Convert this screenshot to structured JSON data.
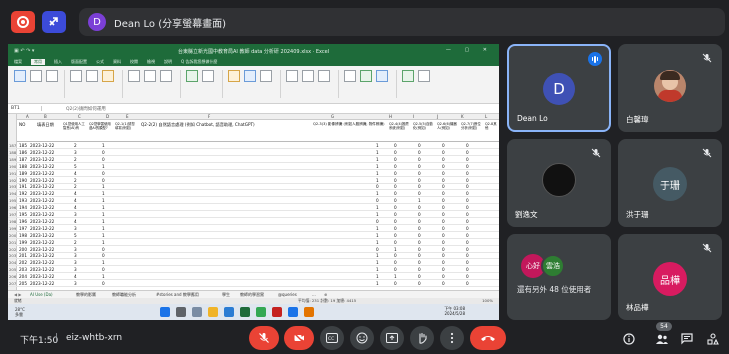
{
  "meeting": {
    "presenter_initial": "D",
    "presenter_label": "Dean Lo (分享螢幕畫面)"
  },
  "excel": {
    "title": "台東縣立新光國中教育局AI 教師 data 分析研 202409.xlsx · Excel",
    "tabs": [
      "檔案",
      "常用",
      "插入",
      "版面配置",
      "公式",
      "資料",
      "校閱",
      "檢視",
      "說明",
      "Q 告訴我您想做什麼"
    ],
    "name_box": "BT1",
    "formula_preview": "Q2(2)請問如何運用",
    "columns": [
      "A",
      "B",
      "C",
      "D",
      "E",
      "F",
      "G",
      "H",
      "I",
      "J",
      "K",
      "L"
    ],
    "headers": [
      "NO",
      "填表日期",
      "Q1您使用人工智慧(AI)有",
      "Q2您學習使用過AI的類型?",
      "Q2-1(1)請您填寫(例如)",
      "Q2-2(2) 自然語言處理 (例如 Chatbot, 語音助理, ChatGPT)",
      "Q2-3(3) 影像辨識 (例如人臉辨識, 物件辨識)",
      "Q2-4(4)推薦系統(例如)",
      "Q2-5(5)自動化(例如)",
      "Q2-6(6)機器人(例如)",
      "Q2-7(7)數位分析(例如)",
      "Q2-8其他"
    ],
    "rows": [
      {
        "rn": "187",
        "no": "185",
        "date": "2023-12-22",
        "c": "2",
        "d": "1",
        "g": "1",
        "h": "0",
        "i": "0",
        "j": "0",
        "k": "0"
      },
      {
        "rn": "188",
        "no": "186",
        "date": "2023-12-22",
        "c": "3",
        "d": "0",
        "g": "1",
        "h": "0",
        "i": "0",
        "j": "0",
        "k": "0"
      },
      {
        "rn": "189",
        "no": "187",
        "date": "2023-12-22",
        "c": "2",
        "d": "0",
        "g": "1",
        "h": "0",
        "i": "0",
        "j": "0",
        "k": "0"
      },
      {
        "rn": "190",
        "no": "188",
        "date": "2023-12-22",
        "c": "5",
        "d": "1",
        "g": "1",
        "h": "0",
        "i": "0",
        "j": "0",
        "k": "0"
      },
      {
        "rn": "191",
        "no": "189",
        "date": "2023-12-22",
        "c": "4",
        "d": "0",
        "g": "1",
        "h": "0",
        "i": "0",
        "j": "0",
        "k": "0"
      },
      {
        "rn": "192",
        "no": "190",
        "date": "2023-12-22",
        "c": "2",
        "d": "0",
        "g": "1",
        "h": "0",
        "i": "0",
        "j": "0",
        "k": "0"
      },
      {
        "rn": "193",
        "no": "191",
        "date": "2023-12-22",
        "c": "2",
        "d": "1",
        "g": "0",
        "h": "0",
        "i": "0",
        "j": "0",
        "k": "0"
      },
      {
        "rn": "194",
        "no": "192",
        "date": "2023-12-22",
        "c": "4",
        "d": "1",
        "g": "1",
        "h": "0",
        "i": "0",
        "j": "0",
        "k": "0"
      },
      {
        "rn": "195",
        "no": "193",
        "date": "2023-12-22",
        "c": "4",
        "d": "1",
        "g": "0",
        "h": "0",
        "i": "1",
        "j": "0",
        "k": "0"
      },
      {
        "rn": "196",
        "no": "194",
        "date": "2023-12-22",
        "c": "4",
        "d": "1",
        "g": "1",
        "h": "0",
        "i": "0",
        "j": "0",
        "k": "0"
      },
      {
        "rn": "197",
        "no": "195",
        "date": "2023-12-22",
        "c": "3",
        "d": "1",
        "g": "1",
        "h": "0",
        "i": "0",
        "j": "0",
        "k": "0"
      },
      {
        "rn": "198",
        "no": "196",
        "date": "2023-12-22",
        "c": "4",
        "d": "1",
        "g": "0",
        "h": "0",
        "i": "0",
        "j": "0",
        "k": "0"
      },
      {
        "rn": "199",
        "no": "197",
        "date": "2023-12-22",
        "c": "3",
        "d": "1",
        "g": "1",
        "h": "0",
        "i": "0",
        "j": "0",
        "k": "0"
      },
      {
        "rn": "200",
        "no": "198",
        "date": "2023-12-22",
        "c": "5",
        "d": "1",
        "g": "1",
        "h": "0",
        "i": "0",
        "j": "0",
        "k": "0"
      },
      {
        "rn": "201",
        "no": "199",
        "date": "2023-12-22",
        "c": "2",
        "d": "1",
        "g": "1",
        "h": "0",
        "i": "0",
        "j": "0",
        "k": "0"
      },
      {
        "rn": "202",
        "no": "200",
        "date": "2023-12-22",
        "c": "3",
        "d": "0",
        "g": "0",
        "h": "1",
        "i": "0",
        "j": "0",
        "k": "0"
      },
      {
        "rn": "203",
        "no": "201",
        "date": "2023-12-22",
        "c": "3",
        "d": "0",
        "g": "1",
        "h": "0",
        "i": "0",
        "j": "0",
        "k": "0"
      },
      {
        "rn": "204",
        "no": "202",
        "date": "2023-12-22",
        "c": "3",
        "d": "1",
        "g": "1",
        "h": "0",
        "i": "0",
        "j": "0",
        "k": "0"
      },
      {
        "rn": "205",
        "no": "203",
        "date": "2023-12-22",
        "c": "3",
        "d": "0",
        "g": "1",
        "h": "0",
        "i": "0",
        "j": "0",
        "k": "0"
      },
      {
        "rn": "206",
        "no": "204",
        "date": "2023-12-22",
        "c": "4",
        "d": "1",
        "g": "1",
        "h": "1",
        "i": "0",
        "j": "0",
        "k": "0"
      },
      {
        "rn": "207",
        "no": "205",
        "date": "2023-12-22",
        "c": "3",
        "d": "0",
        "g": "1",
        "h": "0",
        "i": "0",
        "j": "0",
        "k": "0"
      }
    ],
    "sheet_tabs": [
      "AI Use (Da)",
      "教學的影響",
      "教師職能分析",
      "#stories and 教學應用",
      "學生",
      "教師的學習實",
      "@queries",
      "..."
    ],
    "status_left": "就緒",
    "status_right": "平均值: 231  計數: 19  加總: 4415",
    "zoom": "100%",
    "weather_temp": "28°C",
    "weather_desc": "多雲",
    "clock_time": "下午 03:08",
    "clock_date": "2024/5/28"
  },
  "participants": {
    "dean": {
      "initial": "D",
      "name": "Dean Lo"
    },
    "bai": {
      "name": "白馨瑋"
    },
    "liu": {
      "name": "劉逸文"
    },
    "hong": {
      "avatar_text": "于珊",
      "name": "洪于珊"
    },
    "more": {
      "av1": "心好",
      "av2": "雲浩",
      "text": "還有另外 48 位使用者"
    },
    "lin": {
      "avatar_text": "品樺",
      "name": "林品樺"
    }
  },
  "bottom": {
    "time": "下午1:50",
    "separator": "|",
    "meeting_code": "eiz-whtb-xrn",
    "participant_count": "54"
  },
  "colors": {
    "background": "#202124",
    "tile": "#3c4043",
    "red": "#ea4335",
    "excel_green": "#1e6b3a",
    "active_speaker": "#8ab4f8"
  }
}
